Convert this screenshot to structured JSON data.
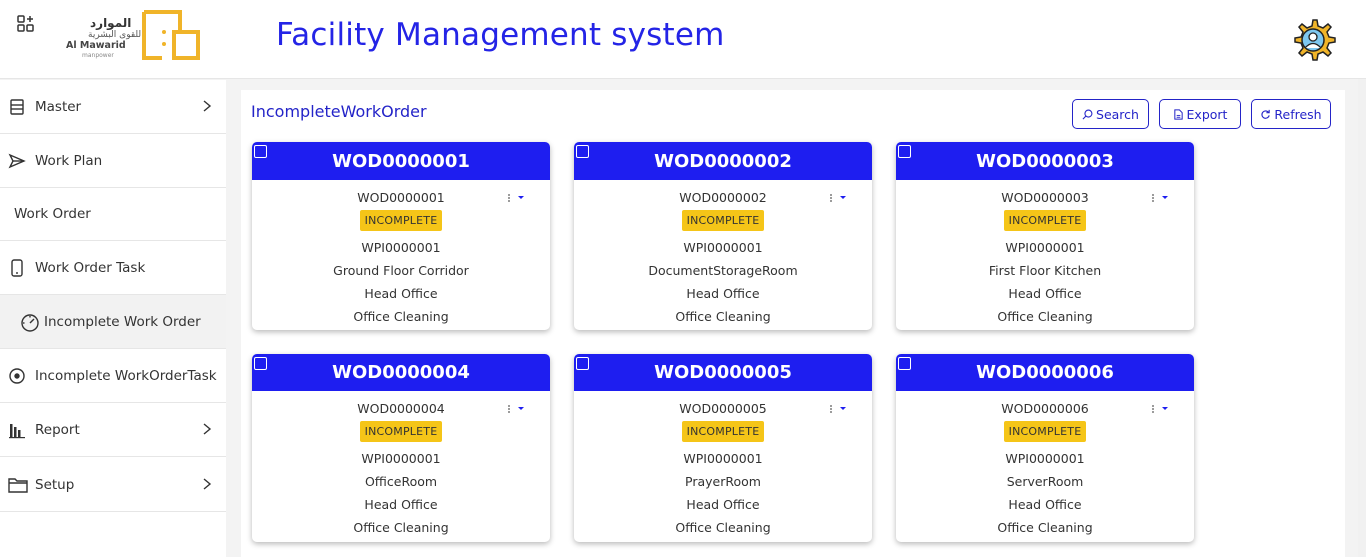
{
  "header": {
    "app_title": "Facility Management system",
    "logo_arabic_1": "الموارد",
    "logo_arabic_2": "للقوى البشرية",
    "logo_english": "Al Mawarid",
    "logo_english_sub": "manpower"
  },
  "sidebar": {
    "items": [
      {
        "label": "Master",
        "icon": "list-icon",
        "chevron": true
      },
      {
        "label": "Work Plan",
        "icon": "send-icon",
        "chevron": false
      },
      {
        "label": "Work Order",
        "icon": "",
        "chevron": false
      },
      {
        "label": "Work Order Task",
        "icon": "phone-icon",
        "chevron": false
      },
      {
        "label": "Incomplete Work Order",
        "icon": "gauge-icon",
        "chevron": false,
        "active": true
      },
      {
        "label": "Incomplete WorkOrderTask",
        "icon": "target-icon",
        "chevron": false
      },
      {
        "label": "Report",
        "icon": "bar-chart-icon",
        "chevron": true
      },
      {
        "label": "Setup",
        "icon": "folder-icon",
        "chevron": true
      }
    ]
  },
  "main": {
    "title": "IncompleteWorkOrder",
    "buttons": {
      "search": "Search",
      "export": "Export",
      "refresh": "Refresh"
    },
    "cards": [
      {
        "header": "WOD0000001",
        "code": "WOD0000001",
        "status": "INCOMPLETE",
        "plan": "WPI0000001",
        "location": "Ground Floor Corridor",
        "site": "Head Office",
        "service": "Office Cleaning"
      },
      {
        "header": "WOD0000002",
        "code": "WOD0000002",
        "status": "INCOMPLETE",
        "plan": "WPI0000001",
        "location": "DocumentStorageRoom",
        "site": "Head Office",
        "service": "Office Cleaning"
      },
      {
        "header": "WOD0000003",
        "code": "WOD0000003",
        "status": "INCOMPLETE",
        "plan": "WPI0000001",
        "location": "First Floor Kitchen",
        "site": "Head Office",
        "service": "Office Cleaning"
      },
      {
        "header": "WOD0000004",
        "code": "WOD0000004",
        "status": "INCOMPLETE",
        "plan": "WPI0000001",
        "location": "OfficeRoom",
        "site": "Head Office",
        "service": "Office Cleaning"
      },
      {
        "header": "WOD0000005",
        "code": "WOD0000005",
        "status": "INCOMPLETE",
        "plan": "WPI0000001",
        "location": "PrayerRoom",
        "site": "Head Office",
        "service": "Office Cleaning"
      },
      {
        "header": "WOD0000006",
        "code": "WOD0000006",
        "status": "INCOMPLETE",
        "plan": "WPI0000001",
        "location": "ServerRoom",
        "site": "Head Office",
        "service": "Office Cleaning"
      }
    ]
  },
  "colors": {
    "accent": "#1e1ef0",
    "title": "#2424e6",
    "badge": "#f5c518",
    "logo": "#f0b429"
  }
}
